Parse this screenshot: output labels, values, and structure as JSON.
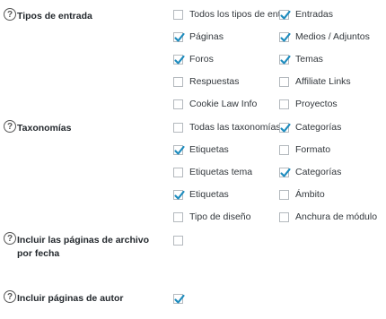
{
  "sections": {
    "post_types": {
      "label": "Tipos de entrada",
      "options": [
        {
          "label": "Todos los tipos de entr",
          "checked": false
        },
        {
          "label": "Entradas",
          "checked": true
        },
        {
          "label": "Páginas",
          "checked": true
        },
        {
          "label": "Medios / Adjuntos",
          "checked": true
        },
        {
          "label": "Foros",
          "checked": true
        },
        {
          "label": "Temas",
          "checked": true
        },
        {
          "label": "Respuestas",
          "checked": false
        },
        {
          "label": "Affiliate Links",
          "checked": false
        },
        {
          "label": "Cookie Law Info",
          "checked": false
        },
        {
          "label": "Proyectos",
          "checked": false
        }
      ]
    },
    "taxonomies": {
      "label": "Taxonomías",
      "options": [
        {
          "label": "Todas las taxonomías",
          "checked": false
        },
        {
          "label": "Categorías",
          "checked": true
        },
        {
          "label": "Etiquetas",
          "checked": true
        },
        {
          "label": "Formato",
          "checked": false
        },
        {
          "label": "Etiquetas tema",
          "checked": false
        },
        {
          "label": "Categorías",
          "checked": true
        },
        {
          "label": "Etiquetas",
          "checked": true
        },
        {
          "label": "Ámbito",
          "checked": false
        },
        {
          "label": "Tipo de diseño",
          "checked": false
        },
        {
          "label": "Anchura de módulo",
          "checked": false
        }
      ]
    },
    "archive_dates": {
      "label": "Incluir las páginas de archivo por fecha",
      "checked": false
    },
    "author_pages": {
      "label": "Incluir páginas de autor",
      "checked": true
    }
  },
  "colors": {
    "checkmark": "#1e8cbe",
    "checkbox_border": "#b4b9be"
  },
  "icons": {
    "help": "question-circle-icon",
    "check": "check-icon"
  }
}
